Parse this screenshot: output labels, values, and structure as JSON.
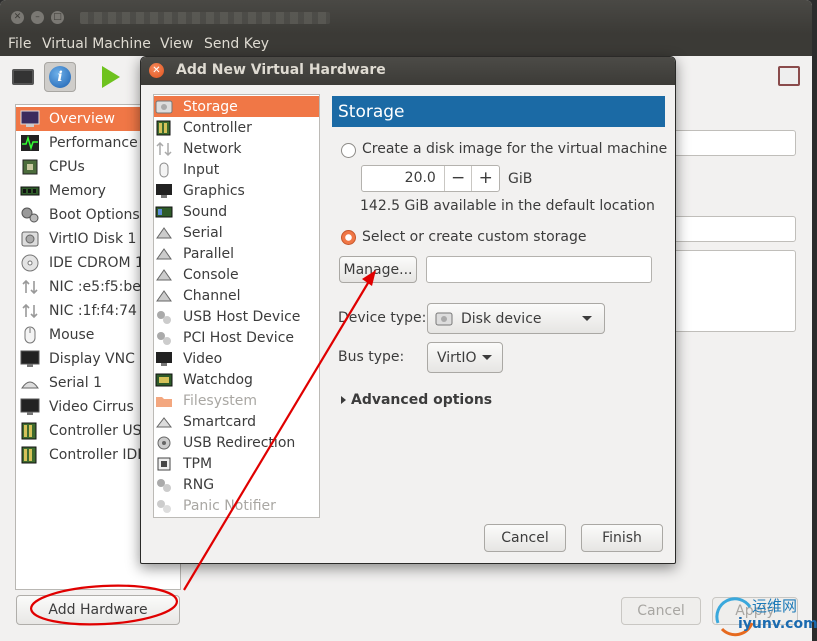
{
  "main_window": {
    "menu": [
      "File",
      "Virtual Machine",
      "View",
      "Send Key"
    ],
    "sidebar_items": [
      {
        "label": "Overview",
        "icon": "overview-icon",
        "selected": true
      },
      {
        "label": "Performance",
        "icon": "performance-icon"
      },
      {
        "label": "CPUs",
        "icon": "cpu-icon"
      },
      {
        "label": "Memory",
        "icon": "memory-icon"
      },
      {
        "label": "Boot Options",
        "icon": "boot-options-icon"
      },
      {
        "label": "VirtIO Disk 1",
        "icon": "disk-icon"
      },
      {
        "label": "IDE CDROM 1",
        "icon": "cdrom-icon"
      },
      {
        "label": "NIC :e5:f5:be",
        "icon": "nic-icon"
      },
      {
        "label": "NIC :1f:f4:74",
        "icon": "nic-icon"
      },
      {
        "label": "Mouse",
        "icon": "mouse-icon"
      },
      {
        "label": "Display VNC",
        "icon": "display-icon"
      },
      {
        "label": "Serial 1",
        "icon": "serial-icon"
      },
      {
        "label": "Video Cirrus",
        "icon": "video-icon"
      },
      {
        "label": "Controller USB",
        "icon": "controller-icon"
      },
      {
        "label": "Controller IDE",
        "icon": "controller-icon"
      }
    ],
    "add_hardware_label": "Add Hardware",
    "cancel_label": "Cancel",
    "apply_label": "Apply"
  },
  "dialog": {
    "title": "Add New Virtual Hardware",
    "hardware_list": [
      {
        "label": "Storage",
        "icon": "storage-icon",
        "selected": true
      },
      {
        "label": "Controller",
        "icon": "controller-icon"
      },
      {
        "label": "Network",
        "icon": "network-icon"
      },
      {
        "label": "Input",
        "icon": "input-icon"
      },
      {
        "label": "Graphics",
        "icon": "graphics-icon"
      },
      {
        "label": "Sound",
        "icon": "sound-icon"
      },
      {
        "label": "Serial",
        "icon": "serial-icon"
      },
      {
        "label": "Parallel",
        "icon": "parallel-icon"
      },
      {
        "label": "Console",
        "icon": "console-icon"
      },
      {
        "label": "Channel",
        "icon": "channel-icon"
      },
      {
        "label": "USB Host Device",
        "icon": "usb-host-icon"
      },
      {
        "label": "PCI Host Device",
        "icon": "pci-host-icon"
      },
      {
        "label": "Video",
        "icon": "video-icon"
      },
      {
        "label": "Watchdog",
        "icon": "watchdog-icon"
      },
      {
        "label": "Filesystem",
        "icon": "filesystem-icon",
        "disabled": true
      },
      {
        "label": "Smartcard",
        "icon": "smartcard-icon"
      },
      {
        "label": "USB Redirection",
        "icon": "usb-redirection-icon"
      },
      {
        "label": "TPM",
        "icon": "tpm-icon"
      },
      {
        "label": "RNG",
        "icon": "rng-icon"
      },
      {
        "label": "Panic Notifier",
        "icon": "panic-notifier-icon",
        "disabled": true
      }
    ],
    "storage": {
      "header": "Storage",
      "create_disk_label": "Create a disk image for the virtual machine",
      "disk_size": "20.0",
      "minus": "−",
      "plus": "+",
      "unit": "GiB",
      "available_text": "142.5 GiB available in the default location",
      "custom_storage_label": "Select or create custom storage",
      "manage_label": "Manage...",
      "path_value": "",
      "device_type_label": "Device type:",
      "device_type_value": "Disk device",
      "bus_type_label": "Bus type:",
      "bus_type_value": "VirtIO",
      "advanced_label": "Advanced options"
    },
    "cancel_label": "Cancel",
    "finish_label": "Finish"
  },
  "watermark": {
    "cn_text": "运维网",
    "domain": "iyunv.com"
  },
  "colors": {
    "selection": "#f07746",
    "header_blue": "#1b6aa5",
    "titlebar": "#3c3b37",
    "annotation_red": "#e00000"
  }
}
